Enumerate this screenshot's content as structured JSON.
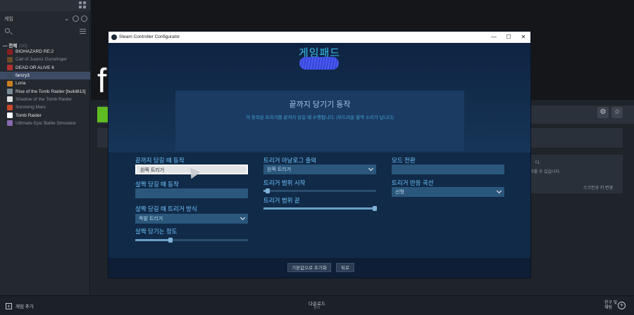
{
  "sidebar": {
    "filter_label": "게임",
    "section_label": "— 전체",
    "section_count": "(10)",
    "games": [
      {
        "name": "BIOHAZARD RE:2",
        "color": "#8a1f1f",
        "dim": false,
        "selected": false
      },
      {
        "name": "Call of Juarez Gunslinger",
        "color": "#6b4a2a",
        "dim": true,
        "selected": false
      },
      {
        "name": "DEAD OR ALIVE 6",
        "color": "#b03030",
        "dim": false,
        "selected": false
      },
      {
        "name": "farcry3",
        "color": "#3a4a5a",
        "dim": false,
        "selected": true
      },
      {
        "name": "Loria",
        "color": "#c8801e",
        "dim": false,
        "selected": false
      },
      {
        "name": "Rise of the Tomb Raider [build813]",
        "color": "#7a8a96",
        "dim": false,
        "selected": false
      },
      {
        "name": "Shadow of the Tomb Raider",
        "color": "#e0e0e0",
        "dim": true,
        "selected": false
      },
      {
        "name": "Surviving Mars",
        "color": "#c84a2a",
        "dim": true,
        "selected": false
      },
      {
        "name": "Tomb Raider",
        "color": "#ffffff",
        "dim": false,
        "selected": false
      },
      {
        "name": "Ultimate Epic Battle Simulator",
        "color": "#8a6ab0",
        "dim": true,
        "selected": false
      }
    ]
  },
  "background_page": {
    "game_initial": "f",
    "text_1": "다.",
    "text_2": "로 플레이할 수 있습니다.",
    "text_3": "스크린샷 키 변경"
  },
  "bottombar": {
    "add_game": "게임 추가",
    "downloads": "다운로드",
    "downloads_sub": "관리",
    "friends_line1": "친구 및",
    "friends_line2": "채팅"
  },
  "window": {
    "title": "Steam Controller Configurator",
    "header": "게임패드",
    "mode_title": "끝까지 당기기 동작",
    "mode_desc": "이 동작은 트리거를 끝까지 당길 때 수행됩니다. (부드러운 딸깍 소리가 납니다)"
  },
  "settings": {
    "full_pull_label": "끝까지 당길 때 동작",
    "full_pull_value": "왼쪽 트리거",
    "soft_pull_label": "살짝 당길 때 동작",
    "soft_pull_value": "",
    "soft_trigger_mode_label": "살짝 당길 때 트리거 방식",
    "soft_trigger_mode_value": "즉발 트리거",
    "soft_pull_threshold_label": "살짝 당기는 정도",
    "soft_pull_threshold_fraction": 0.31,
    "analog_output_label": "트리거 아날로그 출력",
    "analog_output_value": "왼쪽 트리거",
    "range_start_label": "트리거 범위 시작",
    "range_start_fraction": 0.04,
    "range_end_label": "트리거 범위 끝",
    "range_end_fraction": 0.99,
    "mode_shift_label": "모드 전환",
    "mode_shift_value": "",
    "response_curve_label": "트리거 반응 곡선",
    "response_curve_value": "선형"
  },
  "buttons": {
    "reset": "기본값으로 초기화",
    "back": "뒤로"
  },
  "colors": {
    "accent": "#35c0ee",
    "label": "#6ec6ff",
    "selected_row": "#3e4b66"
  }
}
